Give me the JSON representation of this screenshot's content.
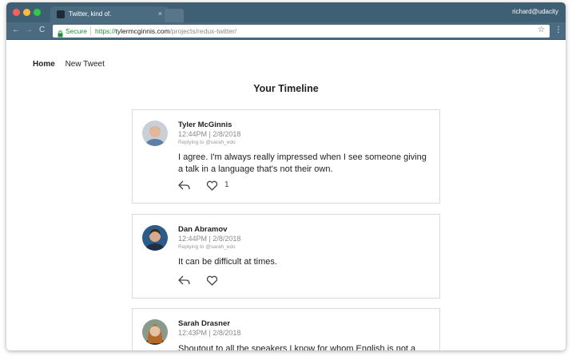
{
  "browser": {
    "tab_title": "Twitter, kind of.",
    "tab_close": "×",
    "user_label": "richard@udacity",
    "secure_label": "Secure",
    "url_scheme": "https://",
    "url_host": "tylermcginnis.com",
    "url_path": "/projects/redux-twitter/",
    "nav_back": "←",
    "nav_forward": "→",
    "nav_reload": "C",
    "star": "☆",
    "menu": "⋮"
  },
  "nav": {
    "home": "Home",
    "new_tweet": "New Tweet"
  },
  "page": {
    "title": "Your Timeline"
  },
  "tweets": [
    {
      "author": "Tyler McGinnis",
      "time": "12:44PM | 2/8/2018",
      "replying_to": "Replying to @sarah_edo",
      "text": "I agree. I'm always really impressed when I see someone giving a talk in a language that's not their own.",
      "likes": "1"
    },
    {
      "author": "Dan Abramov",
      "time": "12:44PM | 2/8/2018",
      "replying_to": "Replying to @sarah_edo",
      "text": "It can be difficult at times.",
      "likes": ""
    },
    {
      "author": "Sarah Drasner",
      "time": "12:43PM | 2/8/2018",
      "text": "Shoutout to all the speakers I know for whom English is not a"
    }
  ],
  "colors": {
    "titlebar": "#3f5f74",
    "toolbar": "#4b6b80",
    "secure_green": "#1e8e3e"
  },
  "icons": {
    "reply": "reply-icon",
    "like": "heart-icon",
    "lock": "lock-icon",
    "star": "star-icon"
  }
}
